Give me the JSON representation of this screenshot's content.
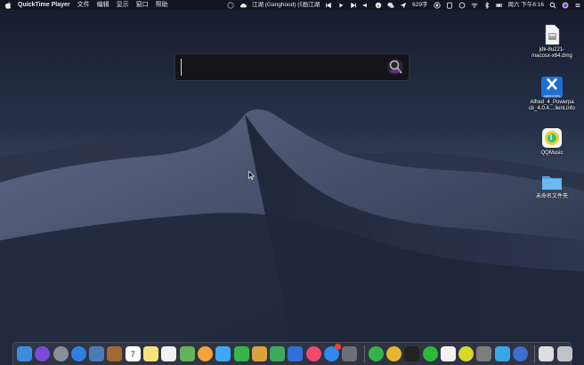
{
  "menubar": {
    "app_name": "QuickTime Player",
    "menus": [
      "文件",
      "编辑",
      "显示",
      "窗口",
      "帮助"
    ],
    "now_playing": "江湖 (Ganghood) (《画江湖",
    "word_count": "629字",
    "clock": "周六 下午6:16"
  },
  "launcher": {
    "query": ""
  },
  "desktop": {
    "icons": [
      {
        "label_line1": "jdk-8u221-",
        "label_line2": "macosx-x64.dmg"
      },
      {
        "label_line1": "Alfred_4_Powerpa",
        "label_line2": "ck_4.0.4....lient.info",
        "image_text": "xclient.info"
      },
      {
        "label_line1": "QQMusic",
        "label_line2": ""
      },
      {
        "label_line1": "未命名文件夹",
        "label_line2": ""
      }
    ]
  },
  "dock": {
    "apps": [
      {
        "name": "finder-icon",
        "color": "#3b8de0"
      },
      {
        "name": "siri-icon",
        "color": "#7a4ad8"
      },
      {
        "name": "launchpad-icon",
        "color": "#8a8f9a"
      },
      {
        "name": "safari-icon",
        "color": "#2f7fe3"
      },
      {
        "name": "preview-icon",
        "color": "#4a7bb5"
      },
      {
        "name": "notebook-icon",
        "color": "#a26a32"
      },
      {
        "name": "calendar-icon",
        "color": "#ffffff"
      },
      {
        "name": "notes-icon",
        "color": "#f4e27a"
      },
      {
        "name": "reminders-icon",
        "color": "#f2f2f2"
      },
      {
        "name": "maps-icon",
        "color": "#64b25a"
      },
      {
        "name": "photos-icon",
        "color": "#f2a33a"
      },
      {
        "name": "messages-icon",
        "color": "#3fa8f5"
      },
      {
        "name": "facetime-icon",
        "color": "#35b64b"
      },
      {
        "name": "keynote-icon",
        "color": "#d9a23a"
      },
      {
        "name": "numbers-icon",
        "color": "#3bab5a"
      },
      {
        "name": "keynote-podium-icon",
        "color": "#2f6fd8"
      },
      {
        "name": "music-icon",
        "color": "#f04a6c"
      },
      {
        "name": "appstore-icon",
        "color": "#2f89f0"
      },
      {
        "name": "system-preferences-icon",
        "color": "#6c6f76"
      },
      {
        "name": "wechat-icon",
        "color": "#33b44a"
      },
      {
        "name": "chrome-icon",
        "color": "#e8b52f"
      },
      {
        "name": "terminal-icon",
        "color": "#222222"
      },
      {
        "name": "app-green-icon",
        "color": "#2dba36"
      },
      {
        "name": "pages-icon",
        "color": "#f2f2f2"
      },
      {
        "name": "app-yellow-icon",
        "color": "#d6d82b"
      },
      {
        "name": "app-gear-icon",
        "color": "#7c7c7c"
      },
      {
        "name": "app-play-icon",
        "color": "#38a6e8"
      },
      {
        "name": "app-globe-icon",
        "color": "#3b6fd0"
      },
      {
        "name": "documents-icon",
        "color": "#dedede"
      },
      {
        "name": "trash-icon",
        "color": "#bfc3c9"
      }
    ],
    "calendar_day": "7"
  }
}
